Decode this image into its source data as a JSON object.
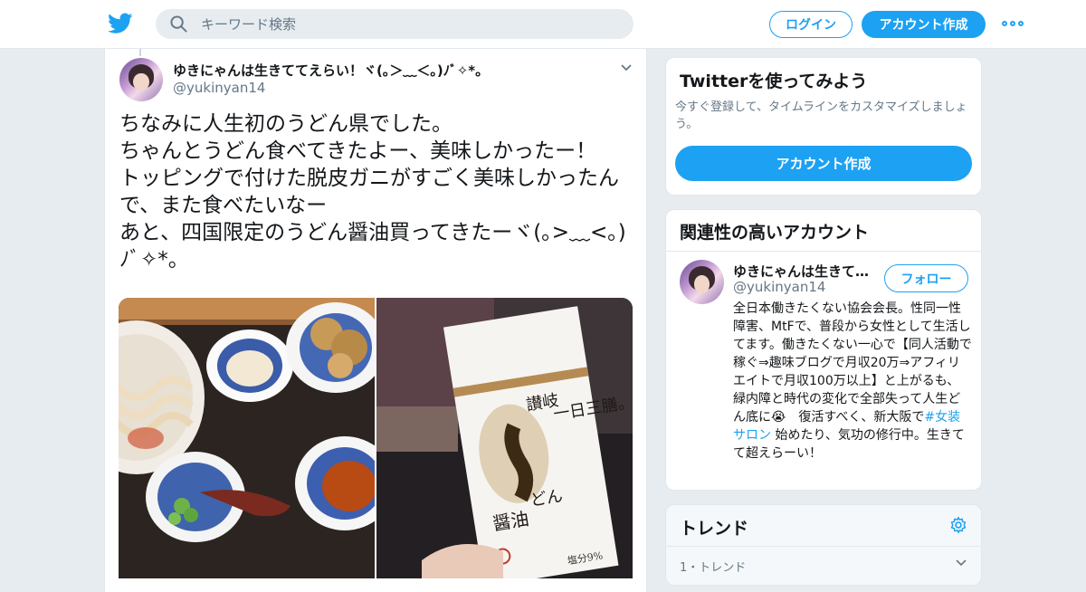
{
  "topbar": {
    "search_placeholder": "キーワード検索",
    "login_label": "ログイン",
    "signup_label": "アカウント作成"
  },
  "tweet": {
    "display_name": "ゆきにゃんは生きててえらい！ヾ(｡＞﹏＜｡)ﾉﾞ✧*。",
    "handle": "@yukinyan14",
    "text": "ちなみに人生初のうどん県でした。\nちゃんとうどん食べてきたよー、美味しかったー！\nトッピングで付けた脱皮ガニがすごく美味しかったんで、また食べたいなー\nあと、四国限定のうどん醤油買ってきたーヾ(｡>﹏<｡)ﾉﾞ✧*。",
    "photos": {
      "left": "udon-meal-photo",
      "right": "udon-soy-sauce-photo",
      "package_text": {
        "brand": "讃岐",
        "main": "う",
        "sub": "どん",
        "sauce": "醤油",
        "tag": "一日三膳。",
        "salt": "塩分9%"
      }
    }
  },
  "sidebar": {
    "try_card": {
      "title": "Twitterを使ってみよう",
      "description": "今すぐ登録して、タイムラインをカスタマイズしましょう。",
      "cta": "アカウント作成"
    },
    "related": {
      "title": "関連性の高いアカウント",
      "name": "ゆきにゃんは生きてててえらい",
      "handle": "@yukinyan14",
      "follow_label": "フォロー",
      "bio_before": "全日本働きたくない協会会長。性同一性障害、MtFで、普段から女性として生活してます。働きたくない一心で【同人活動で稼ぐ⇒趣味ブログで月収20万⇒アフィリエイトで月収100万以上】と上がるも、緑内障と時代の変化で全部失って人生どん底に😭　復活すべく、新大阪で",
      "bio_hashtag": "#女装サロン",
      "bio_after": " 始めたり、気功の修行中。生きてて超えらーい！"
    },
    "trends": {
      "title": "トレンド",
      "first_meta": "1・トレンド"
    }
  },
  "colors": {
    "accent": "#1da1f2",
    "background": "#e6ecf0",
    "secondary_text": "#657786"
  }
}
